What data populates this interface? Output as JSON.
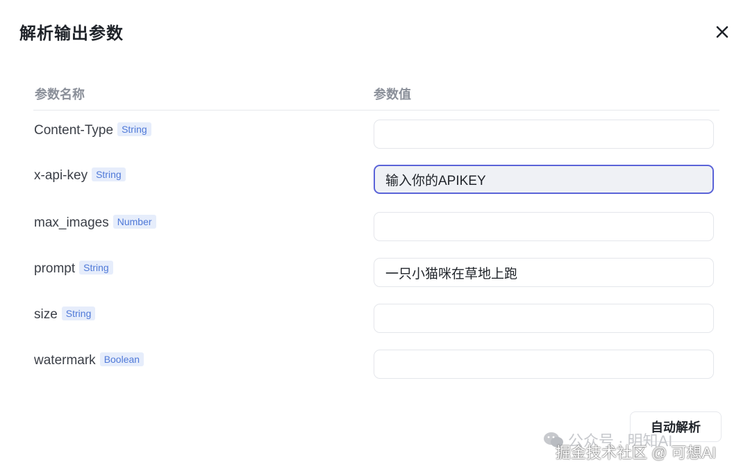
{
  "dialog": {
    "title": "解析输出参数",
    "close_icon": "close-icon"
  },
  "table": {
    "headers": {
      "name": "参数名称",
      "value": "参数值"
    },
    "rows": [
      {
        "name": "Content-Type",
        "type": "String",
        "value": ""
      },
      {
        "name": "x-api-key",
        "type": "String",
        "value": "输入你的APIKEY"
      },
      {
        "name": "max_images",
        "type": "Number",
        "value": ""
      },
      {
        "name": "prompt",
        "type": "String",
        "value": "一只小猫咪在草地上跑"
      },
      {
        "name": "size",
        "type": "String",
        "value": ""
      },
      {
        "name": "watermark",
        "type": "Boolean",
        "value": ""
      }
    ]
  },
  "footer": {
    "auto_parse_label": "自动解析"
  },
  "watermarks": {
    "wechat_icon": "wechat-icon",
    "line1": "公众号 · 明知AI",
    "line2": "掘金技术社区 @ 可想AI"
  },
  "colors": {
    "accent": "#5a63d8",
    "tag_text": "#4f79d8",
    "tag_bg": "#e6edfb"
  }
}
